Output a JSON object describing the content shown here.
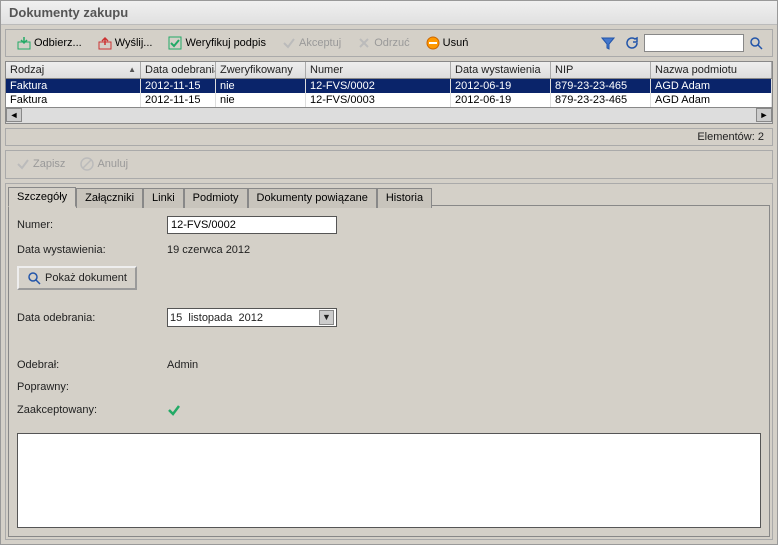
{
  "window": {
    "title": "Dokumenty zakupu"
  },
  "toolbar": {
    "receive": "Odbierz...",
    "send": "Wyślij...",
    "verify": "Weryfikuj podpis",
    "accept": "Akceptuj",
    "reject": "Odrzuć",
    "delete": "Usuń"
  },
  "grid": {
    "columns": {
      "kind": "Rodzaj",
      "received": "Data odebrania",
      "verified": "Zweryfikowany",
      "number": "Numer",
      "issued": "Data wystawienia",
      "nip": "NIP",
      "entity": "Nazwa podmiotu"
    },
    "widths": {
      "kind": 135,
      "received": 75,
      "verified": 90,
      "number": 145,
      "issued": 100,
      "nip": 100,
      "entity": 125
    },
    "rows": [
      {
        "kind": "Faktura",
        "received": "2012-11-15",
        "verified": "nie",
        "number": "12-FVS/0002",
        "issued": "2012-06-19",
        "nip": "879-23-23-465",
        "entity": "AGD Adam",
        "selected": true
      },
      {
        "kind": "Faktura",
        "received": "2012-11-15",
        "verified": "nie",
        "number": "12-FVS/0003",
        "issued": "2012-06-19",
        "nip": "879-23-23-465",
        "entity": "AGD Adam",
        "selected": false
      }
    ]
  },
  "status": {
    "elements_label": "Elementów:",
    "elements_count": "2"
  },
  "formbar": {
    "save": "Zapisz",
    "cancel": "Anuluj"
  },
  "tabs": {
    "details": "Szczegóły",
    "attachments": "Załączniki",
    "links": "Linki",
    "entities": "Podmioty",
    "related": "Dokumenty powiązane",
    "history": "Historia"
  },
  "details": {
    "number_label": "Numer:",
    "number_value": "12-FVS/0002",
    "issued_label": "Data wystawienia:",
    "issued_value": "19 czerwca 2012",
    "show_doc": "Pokaż dokument",
    "received_label": "Data odebrania:",
    "received_day": "15",
    "received_month": "listopada",
    "received_year": "2012",
    "received_by_label": "Odebrał:",
    "received_by_value": "Admin",
    "correct_label": "Poprawny:",
    "accepted_label": "Zaakceptowany:"
  }
}
